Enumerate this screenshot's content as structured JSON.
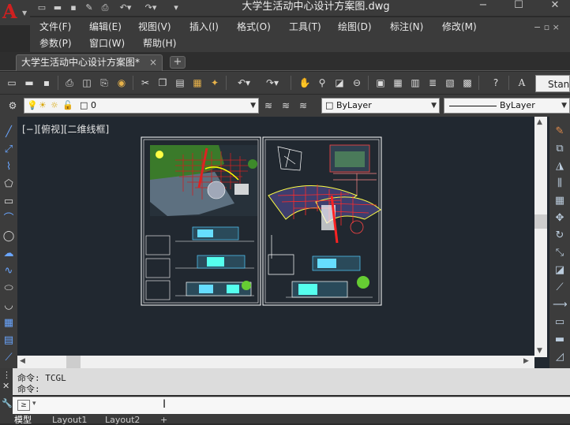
{
  "window": {
    "title": "大学生活动中心设计方案图.dwg"
  },
  "menus": {
    "row1": [
      "文件(F)",
      "编辑(E)",
      "视图(V)",
      "插入(I)",
      "格式(O)",
      "工具(T)",
      "绘图(D)",
      "标注(N)",
      "修改(M)"
    ],
    "row2": [
      "参数(P)",
      "窗口(W)",
      "帮助(H)"
    ]
  },
  "doc_tab": {
    "label": "大学生活动中心设计方案图*",
    "close": "×",
    "new": "+"
  },
  "toolbar": {
    "text_style": "Stand"
  },
  "layer_bar": {
    "layer": "0",
    "color": "ByLayer",
    "linetype": "ByLayer"
  },
  "viewport": {
    "label": "[−][俯视][二维线框]"
  },
  "command": {
    "history_line1": "命令: TCGL",
    "history_line2": "命令:",
    "prompt": "≥"
  },
  "layout_tabs": [
    "模型",
    "Layout1",
    "Layout2",
    "+"
  ],
  "colors": {
    "canvas": "#212830",
    "chrome": "#3b3b3b",
    "accent": "#d02020"
  }
}
